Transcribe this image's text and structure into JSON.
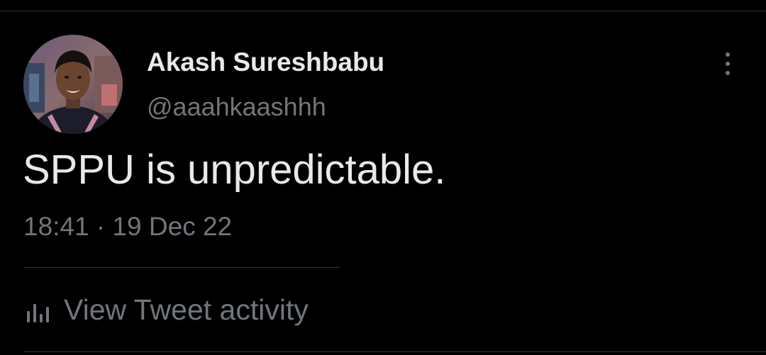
{
  "tweet": {
    "author": {
      "display_name": "Akash Sureshbabu",
      "handle": "@aaahkaashhh",
      "avatar_icon": "profile-photo"
    },
    "text": "SPPU is unpredictable.",
    "timestamp": "18:41 · 19 Dec 22",
    "more_icon": "more-vertical-icon",
    "activity": {
      "label": "View Tweet activity",
      "icon": "bar-chart-icon"
    }
  },
  "colors": {
    "background": "#000000",
    "primary_text": "#e7e9ea",
    "secondary_text": "#71767b",
    "divider": "#2f3336"
  }
}
